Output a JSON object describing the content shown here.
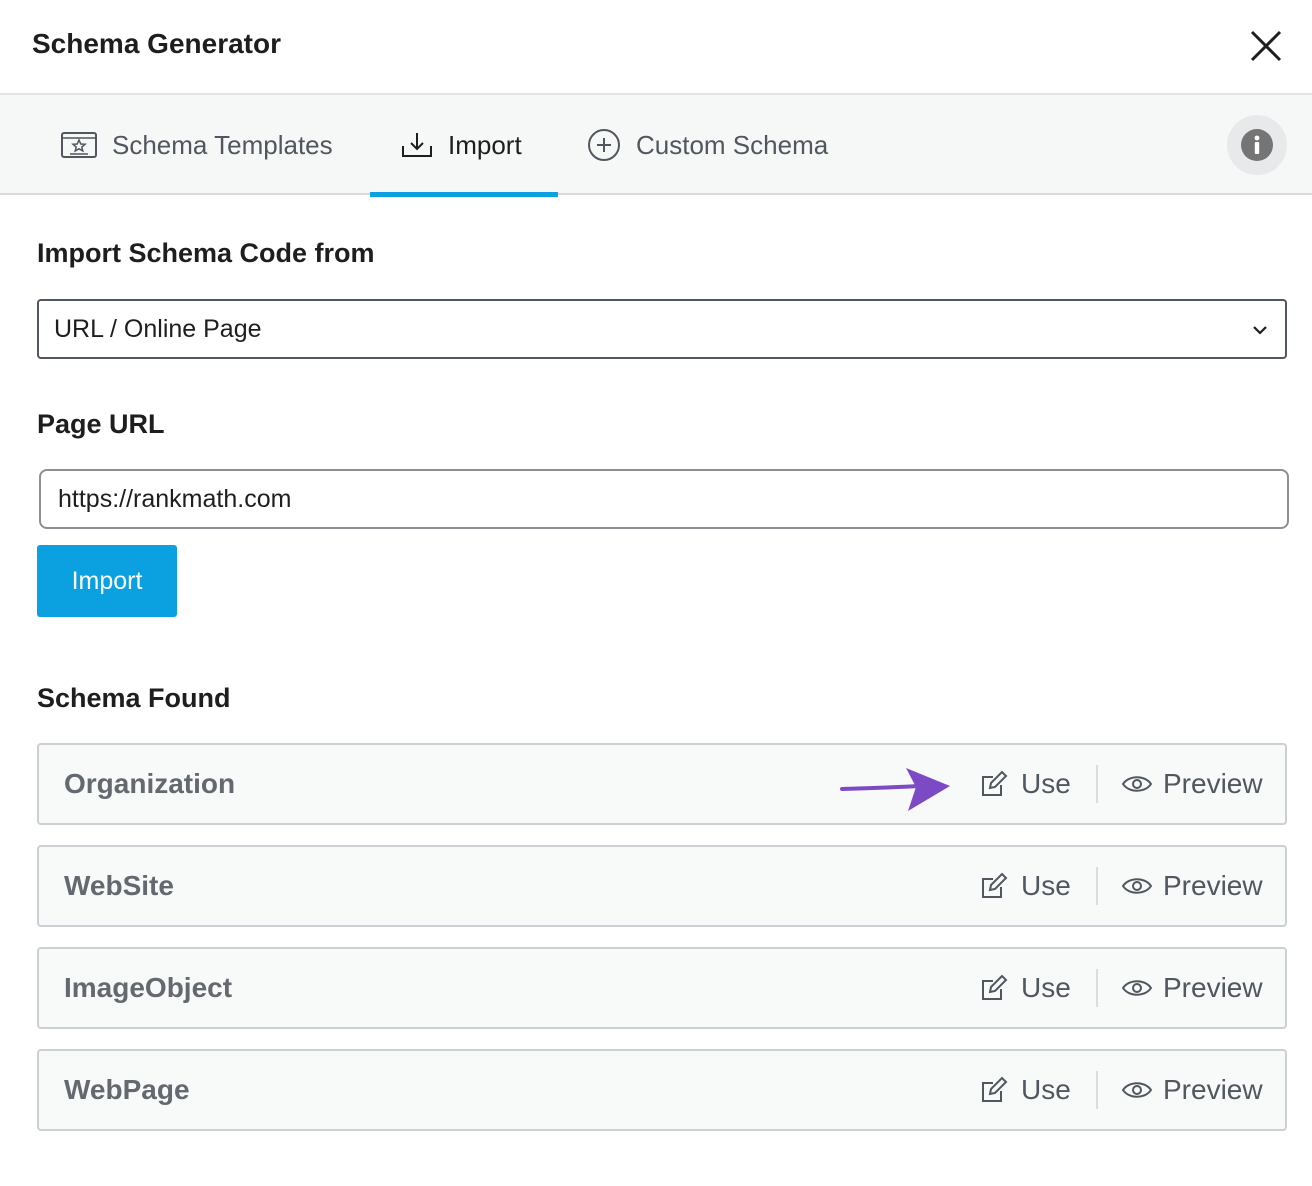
{
  "dialog": {
    "title": "Schema Generator"
  },
  "tabs": [
    {
      "label": "Schema Templates",
      "icon": "schema-templates-icon",
      "active": false
    },
    {
      "label": "Import",
      "icon": "import-icon",
      "active": true
    },
    {
      "label": "Custom Schema",
      "icon": "plus-circle-icon",
      "active": false
    }
  ],
  "import_form": {
    "source_label": "Import Schema Code from",
    "source_value": "URL / Online Page",
    "url_label": "Page URL",
    "url_value": "https://rankmath.com",
    "import_button": "Import"
  },
  "schema_found": {
    "heading": "Schema Found",
    "use_label": "Use",
    "preview_label": "Preview",
    "items": [
      {
        "name": "Organization"
      },
      {
        "name": "WebSite"
      },
      {
        "name": "ImageObject"
      },
      {
        "name": "WebPage"
      }
    ]
  },
  "colors": {
    "accent": "#0ba0e0",
    "annotation_arrow": "#7d4ac5"
  }
}
